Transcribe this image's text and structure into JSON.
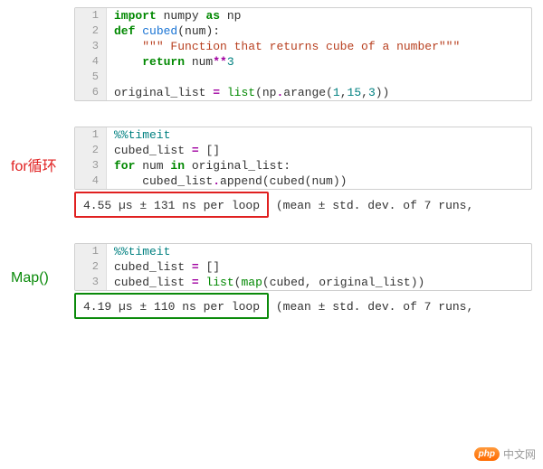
{
  "block1": {
    "lines": [
      {
        "n": "1",
        "html": "<span class='kw'>import</span> <span class='name'>numpy</span> <span class='kw'>as</span> <span class='name'>np</span>"
      },
      {
        "n": "2",
        "html": "<span class='kw'>def</span> <span class='fn'>cubed</span>(num):"
      },
      {
        "n": "3",
        "html": "    <span class='str'>\"\"\" Function that returns cube of a number\"\"\"</span>"
      },
      {
        "n": "4",
        "html": "    <span class='kw'>return</span> num<span class='op'>**</span><span class='num'>3</span>"
      },
      {
        "n": "5",
        "html": ""
      },
      {
        "n": "6",
        "html": "original_list <span class='op'>=</span> <span class='bi'>list</span>(np<span class='op'>.</span>arange(<span class='num'>1</span>,<span class='num'>15</span>,<span class='num'>3</span>))"
      }
    ]
  },
  "block2": {
    "label": "for循环",
    "lines": [
      {
        "n": "1",
        "html": "<span class='mag'>%%timeit</span>"
      },
      {
        "n": "2",
        "html": "cubed_list <span class='op'>=</span> []"
      },
      {
        "n": "3",
        "html": "<span class='kw'>for</span> num <span class='kw'>in</span> original_list:"
      },
      {
        "n": "4",
        "html": "    cubed_list<span class='op'>.</span>append(cubed(num))"
      }
    ],
    "result_highlight": "4.55 µs ± 131 ns per loop",
    "result_tail": " (mean ± std. dev. of 7 runs,"
  },
  "block3": {
    "label": "Map()",
    "lines": [
      {
        "n": "1",
        "html": "<span class='mag'>%%timeit</span>"
      },
      {
        "n": "2",
        "html": "cubed_list <span class='op'>=</span> []"
      },
      {
        "n": "3",
        "html": "cubed_list <span class='op'>=</span> <span class='bi'>list</span>(<span class='bi'>map</span>(cubed, original_list))"
      }
    ],
    "result_highlight": "4.19 µs ± 110 ns per loop",
    "result_tail": " (mean ± std. dev. of 7 runs,"
  },
  "watermark": {
    "badge": "php",
    "text": "中文网"
  }
}
